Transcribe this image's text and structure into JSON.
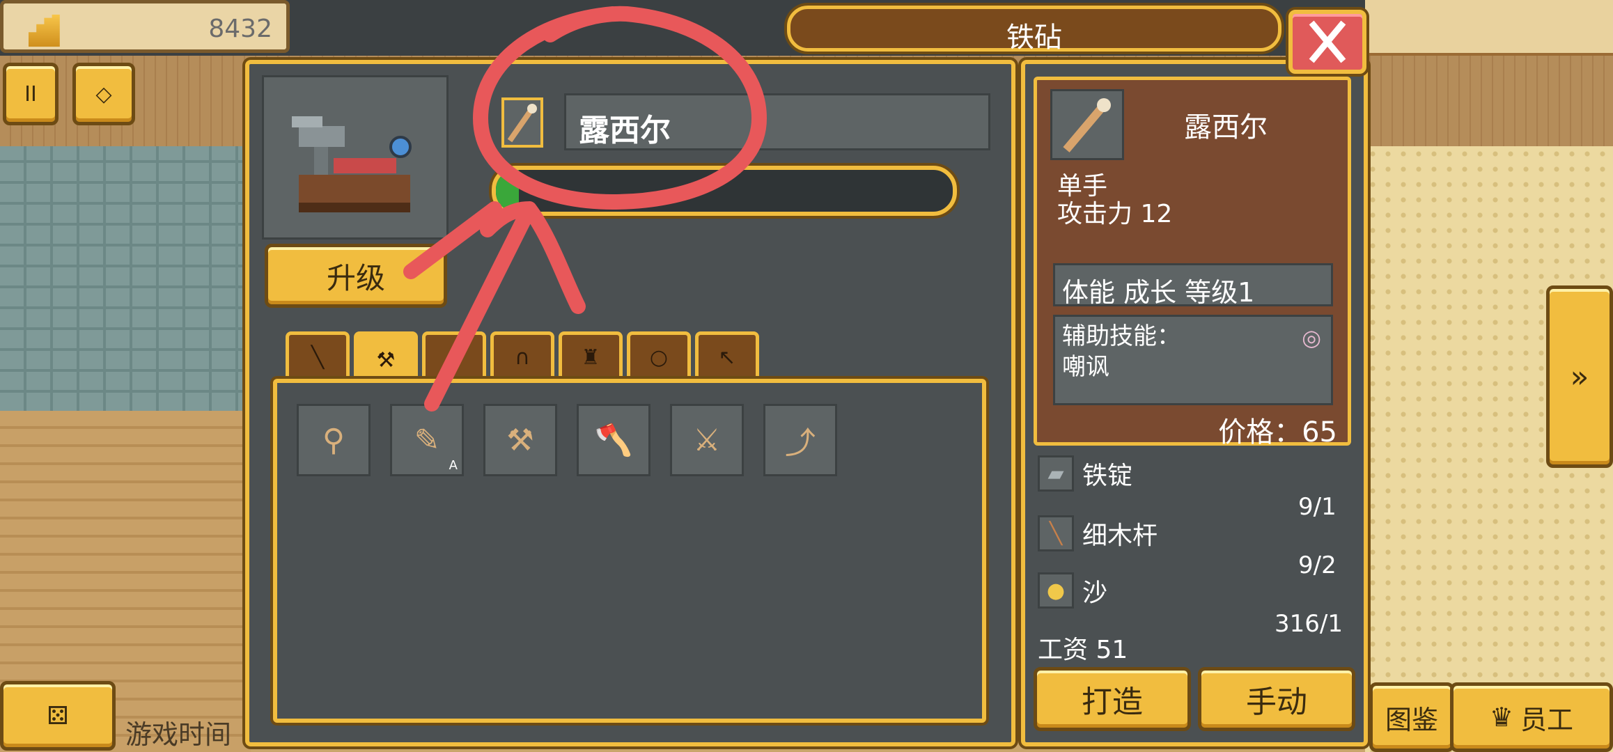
{
  "header": {
    "coins": "8432",
    "title": "铁砧",
    "close_icon": "close-icon"
  },
  "toolbar": {
    "pause_label": "II",
    "extra_label": "◇"
  },
  "editor": {
    "name_value": "露西尔",
    "progress": 0.05,
    "upgrade_label": "升级"
  },
  "tabs": [
    {
      "name": "sword",
      "glyph": "╲",
      "active": false
    },
    {
      "name": "axe",
      "glyph": "⚒",
      "active": true
    },
    {
      "name": "empty",
      "glyph": "",
      "active": false
    },
    {
      "name": "helmet",
      "glyph": "∩",
      "active": false
    },
    {
      "name": "armor",
      "glyph": "♜",
      "active": false
    },
    {
      "name": "ring",
      "glyph": "○",
      "active": false
    },
    {
      "name": "pickaxe",
      "glyph": "↖",
      "active": false
    }
  ],
  "items": [
    {
      "name": "mace",
      "glyph": "⚲",
      "badge": ""
    },
    {
      "name": "spiked-club",
      "glyph": "✎",
      "badge": "A"
    },
    {
      "name": "hammer",
      "glyph": "⚒",
      "badge": ""
    },
    {
      "name": "axe",
      "glyph": "🪓",
      "badge": ""
    },
    {
      "name": "battle-axe",
      "glyph": "⚔",
      "badge": ""
    },
    {
      "name": "scythe",
      "glyph": "⤴",
      "badge": ""
    }
  ],
  "info": {
    "name": "露西尔",
    "hand": "单手",
    "attack": "攻击力 12",
    "growth": "体能 成长 等级1",
    "skill_label": "辅助技能：",
    "skill_name": "嘲讽",
    "price": "价格：65"
  },
  "materials": [
    {
      "name": "铁锭",
      "count": "9/1"
    },
    {
      "name": "细木杆",
      "count": "9/2"
    },
    {
      "name": "沙",
      "count": "316/1"
    }
  ],
  "wage": "工资 51",
  "actions": {
    "craft_label": "打造",
    "manual_label": "手动"
  },
  "footer": {
    "game_time": "游戏时间",
    "guide_label": "图鉴",
    "staff_label": "员工"
  }
}
